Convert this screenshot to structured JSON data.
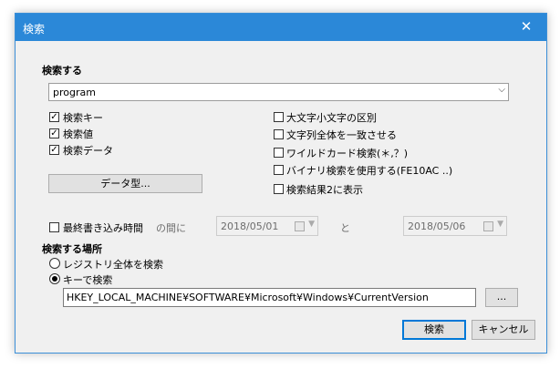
{
  "window": {
    "title": "検索",
    "close_glyph": "✕"
  },
  "search": {
    "label": "検索する",
    "query_value": "program",
    "dropdown_glyph": "⌵"
  },
  "options": {
    "search_key": {
      "label": "検索キー",
      "checked": true
    },
    "search_value": {
      "label": "検索値",
      "checked": true
    },
    "search_data": {
      "label": "検索データ",
      "checked": true
    },
    "case_sensitive": {
      "label": "大文字小文字の区別",
      "checked": false
    },
    "whole_string": {
      "label": "文字列全体を一致させる",
      "checked": false
    },
    "wildcard": {
      "label": "ワイルドカード検索(＊,？)",
      "checked": false
    },
    "binary_search": {
      "label": "バイナリ検索を使用する(FE10AC ..)",
      "checked": false
    },
    "show_results_in_two": {
      "label": "検索結果2に表示",
      "checked": false
    },
    "data_type_button": "データ型..."
  },
  "last_write": {
    "label": "最終書き込み時間",
    "checked": false,
    "between_label": "の間に",
    "from_date": "2018/05/01",
    "and_label": "と",
    "to_date": "2018/05/06"
  },
  "location": {
    "label": "検索する場所",
    "whole_registry": {
      "label": "レジストリ全体を検索",
      "selected": false
    },
    "by_key": {
      "label": "キーで検索",
      "selected": true
    },
    "key_path": "HKEY_LOCAL_MACHINE¥SOFTWARE¥Microsoft¥Windows¥CurrentVersion",
    "browse_button": "..."
  },
  "footer": {
    "search_button": "検索",
    "cancel_button": "キャンセル"
  },
  "colors": {
    "titlebar": "#2b88d8",
    "accent": "#0078d7",
    "dialog_bg": "#f0f0f0"
  },
  "check_glyph": "✓"
}
